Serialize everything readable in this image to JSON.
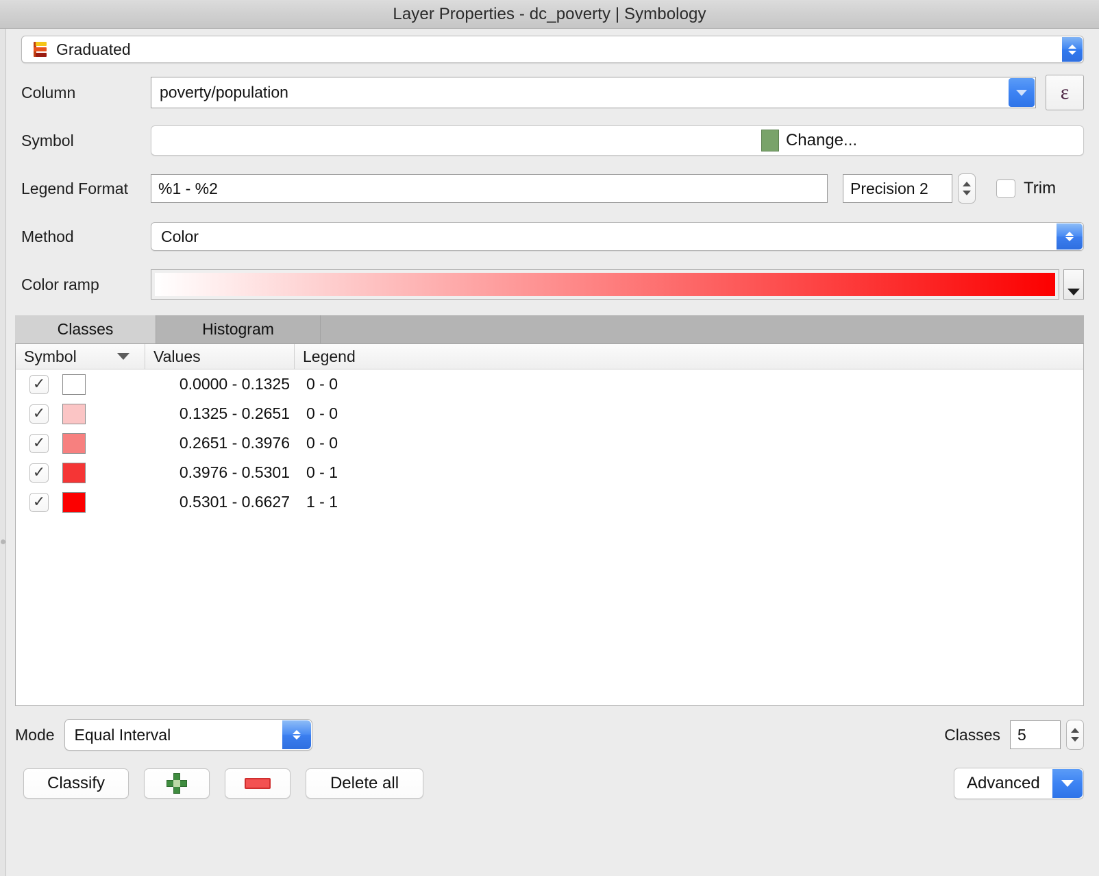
{
  "window": {
    "title": "Layer Properties - dc_poverty | Symbology"
  },
  "renderer": {
    "label": "Graduated",
    "icon": "graduated-symbol-icon",
    "icon_colors": [
      "#f5c518",
      "#e8521e",
      "#9b1b10"
    ]
  },
  "form": {
    "column": {
      "label": "Column",
      "value": "poverty/population",
      "expression_button": "ε"
    },
    "symbol": {
      "label": "Symbol",
      "button_text": "Change...",
      "swatch_color": "#79a36a"
    },
    "legend_format": {
      "label": "Legend Format",
      "value": "%1 - %2",
      "precision_value": "Precision 2",
      "trim_label": "Trim",
      "trim_checked": false
    },
    "method": {
      "label": "Method",
      "value": "Color"
    },
    "color_ramp": {
      "label": "Color ramp",
      "start_color": "#ffffff",
      "end_color": "#fc0000"
    }
  },
  "tabs": [
    {
      "label": "Classes",
      "active": true
    },
    {
      "label": "Histogram",
      "active": false
    }
  ],
  "table": {
    "headers": [
      "Symbol",
      "Values",
      "Legend"
    ],
    "sort_indicator": "descending",
    "rows": [
      {
        "checked": true,
        "color": "#ffffff",
        "values": "0.0000 - 0.1325",
        "legend": "0 - 0"
      },
      {
        "checked": true,
        "color": "#fbc5c5",
        "values": "0.1325 - 0.2651",
        "legend": "0 - 0"
      },
      {
        "checked": true,
        "color": "#f7807f",
        "values": "0.2651 - 0.3976",
        "legend": "0 - 0"
      },
      {
        "checked": true,
        "color": "#f53535",
        "values": "0.3976 - 0.5301",
        "legend": "0 - 1"
      },
      {
        "checked": true,
        "color": "#fc0000",
        "values": "0.5301 - 0.6627",
        "legend": "1 - 1"
      }
    ]
  },
  "mode": {
    "label": "Mode",
    "value": "Equal Interval"
  },
  "classes": {
    "label": "Classes",
    "value": "5"
  },
  "buttons": {
    "classify": "Classify",
    "add": "add-class-icon",
    "remove": "remove-class-icon",
    "delete_all": "Delete all",
    "advanced": "Advanced"
  },
  "colors": {
    "accent_blue": "#3d83f3",
    "window_bg": "#ececec",
    "titlebar_bg": "#d0d0d0"
  }
}
